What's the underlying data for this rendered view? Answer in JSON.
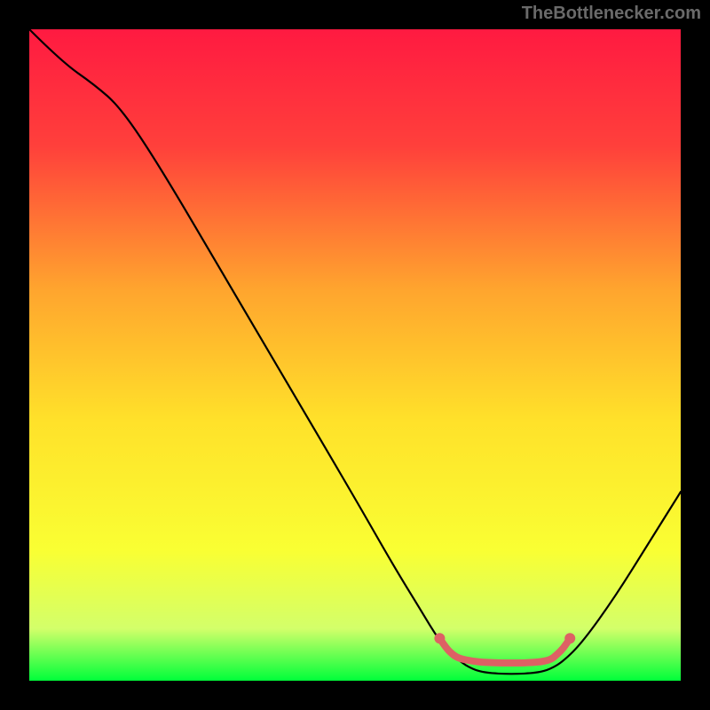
{
  "watermark": "TheBottlenecker.com",
  "chart_data": {
    "type": "line",
    "title": "",
    "xlabel": "",
    "ylabel": "",
    "xlim": [
      0,
      100
    ],
    "ylim": [
      0,
      100
    ],
    "background_gradient": {
      "stops": [
        {
          "offset": 0,
          "color": "#ff1a41"
        },
        {
          "offset": 18,
          "color": "#ff403b"
        },
        {
          "offset": 40,
          "color": "#ffa52e"
        },
        {
          "offset": 60,
          "color": "#ffe12a"
        },
        {
          "offset": 80,
          "color": "#f9ff33"
        },
        {
          "offset": 92,
          "color": "#d3ff6a"
        },
        {
          "offset": 100,
          "color": "#00ff3a"
        }
      ]
    },
    "series": [
      {
        "name": "bottleneck-curve",
        "stroke": "#000000",
        "points": [
          {
            "x": 0,
            "y": 100
          },
          {
            "x": 5,
            "y": 95
          },
          {
            "x": 10,
            "y": 91.5
          },
          {
            "x": 14,
            "y": 88
          },
          {
            "x": 20,
            "y": 79
          },
          {
            "x": 30,
            "y": 62
          },
          {
            "x": 40,
            "y": 45
          },
          {
            "x": 50,
            "y": 28
          },
          {
            "x": 56,
            "y": 17.5
          },
          {
            "x": 60,
            "y": 11
          },
          {
            "x": 63,
            "y": 6
          },
          {
            "x": 66,
            "y": 3
          },
          {
            "x": 68,
            "y": 1.8
          },
          {
            "x": 70,
            "y": 1.2
          },
          {
            "x": 74,
            "y": 1.0
          },
          {
            "x": 78,
            "y": 1.2
          },
          {
            "x": 80,
            "y": 1.8
          },
          {
            "x": 82,
            "y": 3
          },
          {
            "x": 85,
            "y": 6
          },
          {
            "x": 90,
            "y": 13
          },
          {
            "x": 95,
            "y": 21
          },
          {
            "x": 100,
            "y": 29
          }
        ]
      },
      {
        "name": "optimal-band-marker",
        "stroke": "#dd6164",
        "points": [
          {
            "x": 63,
            "y": 6.5
          },
          {
            "x": 64,
            "y": 5
          },
          {
            "x": 65,
            "y": 4
          },
          {
            "x": 66,
            "y": 3.4
          },
          {
            "x": 68,
            "y": 3
          },
          {
            "x": 70,
            "y": 2.8
          },
          {
            "x": 74,
            "y": 2.7
          },
          {
            "x": 78,
            "y": 2.8
          },
          {
            "x": 80,
            "y": 3.2
          },
          {
            "x": 81,
            "y": 4
          },
          {
            "x": 82,
            "y": 5
          },
          {
            "x": 83,
            "y": 6.5
          }
        ],
        "endpoint_dots": true
      }
    ]
  }
}
